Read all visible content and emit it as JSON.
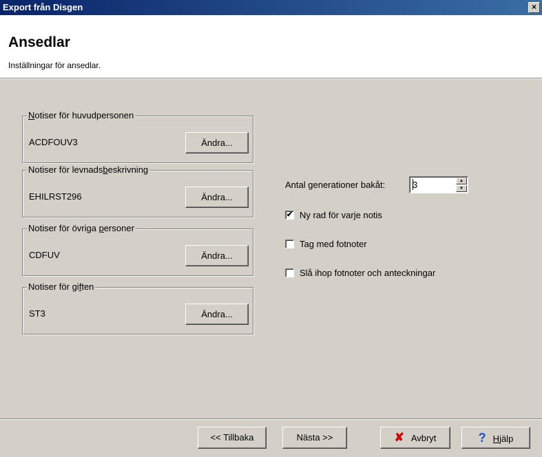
{
  "window": {
    "title": "Export från Disgen",
    "close_label": "×"
  },
  "header": {
    "title": "Ansedlar",
    "subtitle": "Inställningar för ansedlar."
  },
  "groups": [
    {
      "legend_pre": "",
      "legend_key": "N",
      "legend_post": "otiser för huvudpersonen",
      "value": "ACDFOUV3",
      "button": "Ändra..."
    },
    {
      "legend_pre": "Notiser för levnads",
      "legend_key": "b",
      "legend_post": "eskrivning",
      "value": "EHILRST296",
      "button": "Ändra..."
    },
    {
      "legend_pre": "Notiser för övriga ",
      "legend_key": "p",
      "legend_post": "ersoner",
      "value": "CDFUV",
      "button": "Ändra..."
    },
    {
      "legend_pre": "Notiser för gi",
      "legend_key": "f",
      "legend_post": "ten",
      "value": "ST3",
      "button": "Ändra..."
    }
  ],
  "generations": {
    "label_pre": "Antal ",
    "label_key": "g",
    "label_post": "enerationer bakåt:",
    "value": "3"
  },
  "options": [
    {
      "label": "Ny rad för varje notis",
      "checked": true,
      "mark": "✔"
    },
    {
      "label": "Tag med fotnoter",
      "checked": false,
      "mark": ""
    },
    {
      "label": "Slå ihop fotnoter och anteckningar",
      "checked": false,
      "mark": ""
    }
  ],
  "buttons": {
    "back": "<< Tillbaka",
    "next": "Nästa >>",
    "cancel": "Avbryt",
    "help_key": "H",
    "help_post": "jälp",
    "cancel_icon": "✘",
    "help_icon": "?"
  }
}
